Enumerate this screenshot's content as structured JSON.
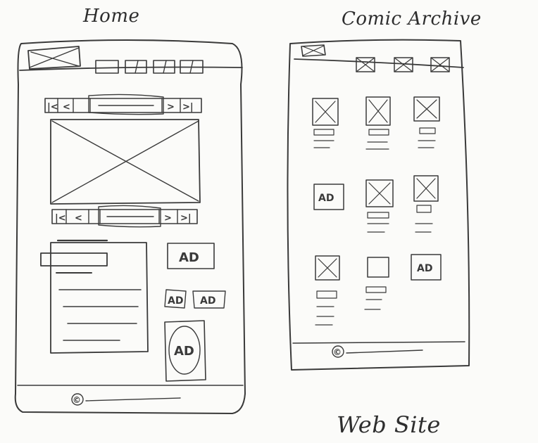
{
  "labels": {
    "left_title": "Home",
    "right_title": "Comic Archive",
    "bottom_caption": "Web Site"
  },
  "home": {
    "nav_prev_symbols": [
      "|<",
      "<"
    ],
    "nav_next_symbols": [
      ">",
      ">|"
    ],
    "ad_labels": [
      "AD",
      "AD",
      "AD",
      "AD"
    ],
    "copyright_symbol": "©"
  },
  "archive": {
    "ad_labels": [
      "AD",
      "AD"
    ],
    "copyright_symbol": "©"
  },
  "colors": {
    "paper": "#fbfbf9",
    "ink": "#3a3a3a"
  }
}
